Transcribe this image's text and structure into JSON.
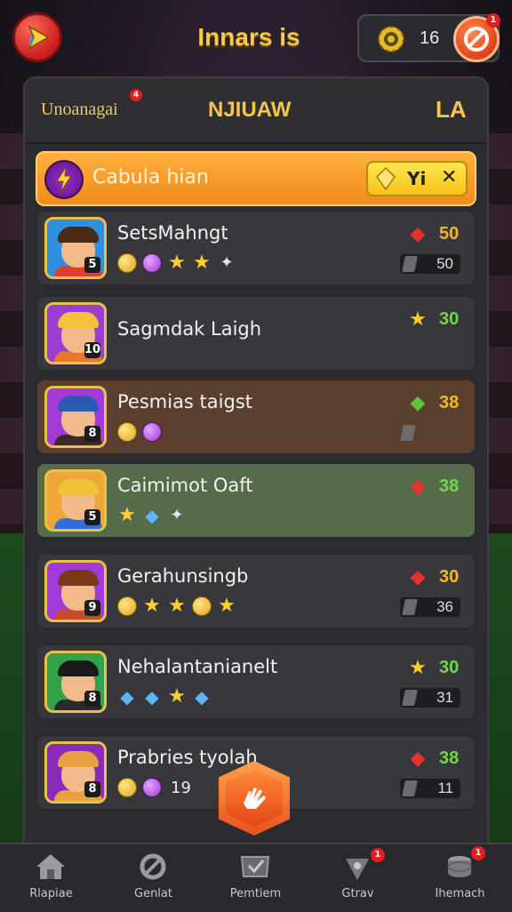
{
  "header": {
    "title": "Innars is",
    "coins": "16",
    "power_badge": "1"
  },
  "panel": {
    "left_label": "Unoanagai",
    "left_badge": "4",
    "mid_label": "NJIUAW",
    "right_label": "LA"
  },
  "banner": {
    "label": "Cabula hian",
    "chip_text": "Yi"
  },
  "rows": [
    {
      "name": "SetsMahngt",
      "avatar_num": "5",
      "score": "50",
      "score_color": "#f5b52a",
      "rank_icon": "red-diamond",
      "sub_value": "50",
      "icons": [
        "gold",
        "purple",
        "star",
        "star",
        "white"
      ]
    },
    {
      "name": "Sagmdak Laigh",
      "avatar_num": "10",
      "score": "30",
      "score_color": "#6cd84a",
      "rank_icon": "gold-star",
      "sub_value": "",
      "icons": []
    },
    {
      "name": "Pesmias taigst",
      "avatar_num": "8",
      "score": "38",
      "score_color": "#f5b52a",
      "rank_icon": "green-diamond",
      "sub_value": "",
      "icons": [
        "gold",
        "purple"
      ]
    },
    {
      "name": "Caimimot Oaft",
      "avatar_num": "5",
      "score": "38",
      "score_color": "#6cd84a",
      "rank_icon": "red-diamond",
      "sub_value": "",
      "icons": [
        "star",
        "blue",
        "white"
      ]
    },
    {
      "name": "Gerahunsingb",
      "avatar_num": "9",
      "score": "30",
      "score_color": "#f5b52a",
      "rank_icon": "red-diamond",
      "sub_value": "36",
      "icons": [
        "gold",
        "star",
        "star",
        "gold",
        "star"
      ]
    },
    {
      "name": "Nehalantanianelt",
      "avatar_num": "8",
      "score": "30",
      "score_color": "#6cd84a",
      "rank_icon": "gold-star",
      "sub_value": "31",
      "icons": [
        "blue",
        "blue",
        "star",
        "blue"
      ]
    },
    {
      "name": "Prabries tyolah",
      "avatar_num": "8",
      "score": "38",
      "score_color": "#6cd84a",
      "rank_icon": "red-diamond",
      "sub_value": "11",
      "icons": [
        "gold",
        "purple"
      ],
      "icon_count": "19"
    }
  ],
  "nav": [
    {
      "label": "Rlapiae",
      "icon": "home-icon"
    },
    {
      "label": "Genlat",
      "icon": "refresh-icon"
    },
    {
      "label": "Pemtiem",
      "icon": "shield-check-icon",
      "badge": ""
    },
    {
      "label": "Gtrav",
      "icon": "map-pin-icon",
      "badge": "1"
    },
    {
      "label": "Ihemach",
      "icon": "coin-stack-icon",
      "badge": "1"
    }
  ],
  "colors": {
    "accent": "#f5c64b",
    "banner": "#f08a1d",
    "danger": "#e51c1c"
  }
}
